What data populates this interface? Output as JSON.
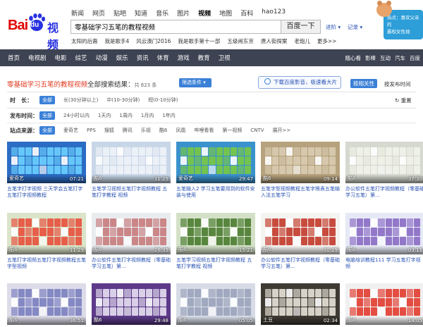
{
  "header": {
    "logo_bai": "Bai",
    "logo_du": "du",
    "logo_product": "视频",
    "nav": [
      "新闻",
      "网页",
      "贴吧",
      "知道",
      "音乐",
      "图片",
      "视频",
      "地图",
      "百科",
      "hao123"
    ],
    "nav_active_index": 6,
    "search_value": "零基础学习五笔的教程视频",
    "search_button": "百度一下",
    "advanced_search": "进阶 ▾",
    "history": "记录 ▾",
    "hot_searches": [
      "太阳的后裔",
      "我是歌手4",
      "风云澳门2016",
      "我是歌手第十一部",
      "五级闹东京",
      "唐人街探案",
      "老炮儿",
      "更多>>"
    ],
    "promo_text": [
      "热点：喜欢父亲的",
      "霸权女性视"
    ]
  },
  "mainnav": {
    "items": [
      "首页",
      "电视剧",
      "电影",
      "综艺",
      "动漫",
      "娱乐",
      "资讯",
      "体育",
      "游戏",
      "教育",
      "卫视"
    ],
    "right_items": [
      "随心看",
      "影棒",
      "互动",
      "汽车",
      "百度"
    ]
  },
  "results": {
    "query": "零基础学习五笔的教程视频",
    "suffix": "全部搜索结果：",
    "count": "共 623 条",
    "filter_button": "筛选条件 ▾",
    "download_button": "下载百度影音，极速看大片",
    "sort_active": "按相关性",
    "sort_other": "按发布时间"
  },
  "filters": [
    {
      "label": "时　长：",
      "options": [
        "全部",
        "长(30分钟以上)",
        "中(10-30分钟)",
        "短(0-10分钟)"
      ]
    },
    {
      "label": "发布时间：",
      "options": [
        "全部",
        "24小时以内",
        "1天内",
        "1周内",
        "1月内",
        "1年内"
      ]
    },
    {
      "label": "站点来源：",
      "options": [
        "全部",
        "爱奇艺",
        "PPS",
        "搜狐",
        "腾讯",
        "乐视",
        "酷6",
        "凤凰",
        "哔哩看看",
        "第一视频",
        "CNTV",
        "展开>>"
      ]
    }
  ],
  "reset": "↻ 重置",
  "videos": [
    {
      "source": "爱奇艺",
      "duration": "07:21",
      "title": "五笔字打字视频 三天学会五笔打字 五笔打字视频教程",
      "bg": "#2b6cc4",
      "kb": "#6bd1ff"
    },
    {
      "source": "酷6",
      "duration": "11:25",
      "title": "五笔学习视频五笔打字视频教程 五笔打字教程 视频",
      "bg": "#c8d7e8",
      "kb": "#f0f3f8"
    },
    {
      "source": "爱奇艺",
      "duration": "29:47",
      "title": "五笔输入2 学习五笔要用到的软件安装与使用",
      "bg": "#3a92cc",
      "kb": "#7ac943"
    },
    {
      "source": "酷6",
      "duration": "09:14",
      "title": "五笔字型视频教程五笔字根表五笔输入法五笔学习",
      "bg": "#b6a27d",
      "kb": "#d9ccb2"
    },
    {
      "source": "酷6",
      "duration": "37:30",
      "title": "办公软件五笔打字视频教程（零基础学习五笔）第...",
      "bg": "#d5d9cf",
      "kb": "#f2f2ea"
    },
    {
      "source": "酷6",
      "duration": "11:29",
      "title": "五笔打字视频五笔打字视频教程五笔字型视频",
      "bg": "#dbe4c9",
      "kb": "#e84f3c"
    },
    {
      "source": "酷6",
      "duration": "26:35",
      "title": "办公软件五笔打字视频教程（零基础学习五笔）第...",
      "bg": "#e9ecef",
      "kb": "#c87b7b"
    },
    {
      "source": "酷6",
      "duration": "15:21",
      "title": "五笔学习视频五笔打字视频教程 五笔打字教程 视频",
      "bg": "#d3e0c7",
      "kb": "#4a7c2f"
    },
    {
      "source": "酷6",
      "duration": "30:29",
      "title": "办公软件五笔打字视频教程（零基础学习五笔）第...",
      "bg": "#f5f3f0",
      "kb": "#c23a2a"
    },
    {
      "source": "酷6",
      "duration": "03:11",
      "title": "电脑培训教程111 学习五笔打字视频",
      "bg": "#e6e9f5",
      "kb": "#8a6bc4"
    },
    {
      "source": "酷6",
      "duration": "36:51",
      "title": "",
      "bg": "#dcdbe8",
      "kb": "#7a7fc0"
    },
    {
      "source": "酷6",
      "duration": "29:48",
      "title": "",
      "bg": "#5d3a8a",
      "kb": "#e7e1f1"
    },
    {
      "source": "酷6",
      "duration": "05:05",
      "title": "",
      "bg": "#d6dbe6",
      "kb": "#9aa3ba"
    },
    {
      "source": "土豆",
      "duration": "02:34",
      "title": "",
      "bg": "#3f3a33",
      "kb": "#e7e3d8"
    },
    {
      "source": "酷6",
      "duration": "14:05",
      "title": "",
      "bg": "#f0f0f0",
      "kb": "#e23b2e"
    }
  ]
}
